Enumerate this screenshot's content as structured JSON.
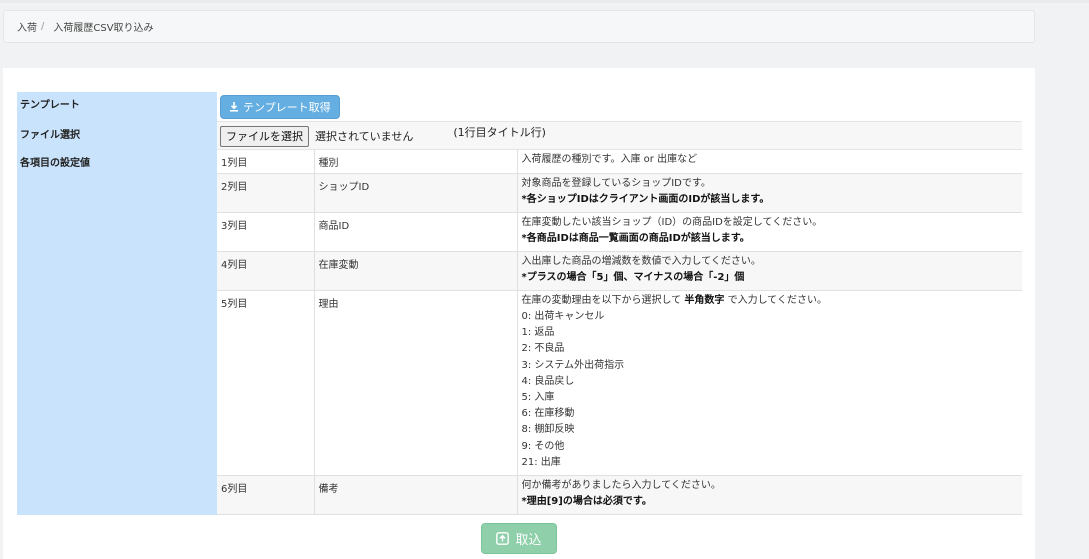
{
  "breadcrumb": {
    "items": [
      "入荷",
      "入荷履歴CSV取り込み"
    ],
    "separator": "/"
  },
  "template": {
    "label": "テンプレート",
    "button_label": "テンプレート取得",
    "button_icon": "download-icon"
  },
  "file": {
    "label": "ファイル選択",
    "button_label": "ファイルを選択",
    "status": "選択されていません",
    "note": "(1行目タイトル行)"
  },
  "settings": {
    "label": "各項目の設定値",
    "rows": [
      {
        "col": "1列目",
        "name": "種別",
        "desc": "入荷履歴の種別です。入庫 or 出庫など",
        "note": ""
      },
      {
        "col": "2列目",
        "name": "ショップID",
        "desc": "対象商品を登録しているショップIDです。",
        "note": "*各ショップIDはクライアント画面のIDが該当します。"
      },
      {
        "col": "3列目",
        "name": "商品ID",
        "desc": "在庫変動したい該当ショップ（ID）の商品IDを設定してください。",
        "note": "*各商品IDは商品一覧画面の商品IDが該当します。"
      },
      {
        "col": "4列目",
        "name": "在庫変動",
        "desc": "入出庫した商品の増減数を数値で入力してください。",
        "note": "*プラスの場合「5」個、マイナスの場合「-2」個"
      },
      {
        "col": "5列目",
        "name": "理由",
        "desc_prefix": "在庫の変動理由を以下から選択して",
        "desc_bold": "半角数字",
        "desc_suffix": "で入力してください。",
        "reasons": [
          "0: 出荷キャンセル",
          "1: 返品",
          "2: 不良品",
          "3: システム外出荷指示",
          "4: 良品戻し",
          "5: 入庫",
          "6: 在庫移動",
          "8: 棚卸反映",
          "9: その他",
          "21: 出庫"
        ]
      },
      {
        "col": "6列目",
        "name": "備考",
        "desc": "何か備考がありましたら入力してください。",
        "note": "*理由[9]の場合は必須です。"
      }
    ]
  },
  "import": {
    "button_label": "取込",
    "button_icon": "upload-icon",
    "color": "#8fd0ab"
  },
  "colors": {
    "label_bg": "#c8e3fb",
    "template_button": "#4ba1dd"
  }
}
